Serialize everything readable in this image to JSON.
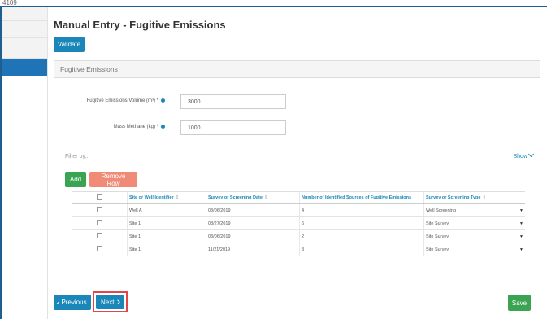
{
  "window": {
    "corner_label": "4109"
  },
  "page": {
    "title": "Manual Entry - Fugitive Emissions"
  },
  "toolbar": {
    "validate_label": "Validate"
  },
  "panel": {
    "title": "Fugitive Emissions",
    "fields": [
      {
        "label": "Fugitive Emissions Volume (m³) *",
        "value": "3000"
      },
      {
        "label": "Mass Methane (kg) *",
        "value": "1000"
      }
    ],
    "filter_placeholder": "Filter by...",
    "show_label": "Show",
    "add_label": "Add",
    "remove_label": "Remove Row"
  },
  "table": {
    "columns": [
      "",
      "Site or Well Identifier",
      "Survey or Screening Date",
      "Number of Identified Sources of Fugitive Emissions",
      "Survey or Screening Type"
    ],
    "rows": [
      {
        "site": "Well A",
        "date": "08/06/2019",
        "sources": "4",
        "type": "Well Screening"
      },
      {
        "site": "Site 1",
        "date": "08/27/2019",
        "sources": "6",
        "type": "Site Survey"
      },
      {
        "site": "Site 1",
        "date": "03/06/2019",
        "sources": "2",
        "type": "Site Survey"
      },
      {
        "site": "Site 1",
        "date": "11/21/2019",
        "sources": "3",
        "type": "Site Survey"
      }
    ]
  },
  "footer": {
    "previous_label": "Previous",
    "next_label": "Next",
    "save_label": "Save"
  },
  "colors": {
    "primary": "#1a87b8",
    "success": "#3aa453",
    "danger": "#ef8b76",
    "highlight": "#e0474c"
  }
}
